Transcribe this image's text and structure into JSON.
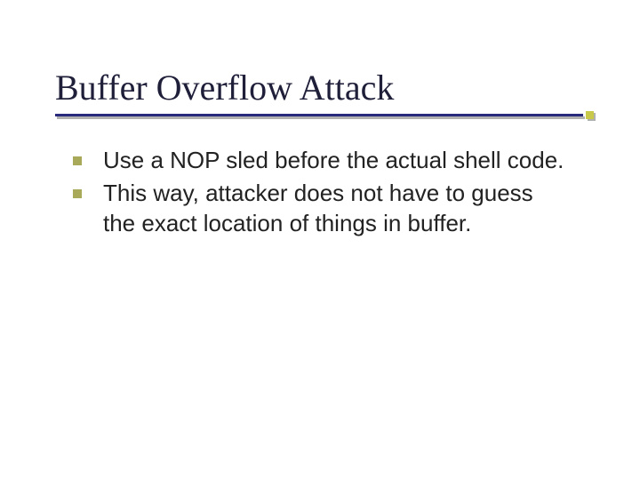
{
  "slide": {
    "title": "Buffer Overflow Attack",
    "bullets": [
      "Use a NOP sled before the actual shell code.",
      "This way, attacker does not have to guess the exact location of things in buffer."
    ]
  },
  "colors": {
    "accent_square": "#a9a95a",
    "rule_blue": "#2a2a7c",
    "title_color": "#1f1f3a"
  }
}
